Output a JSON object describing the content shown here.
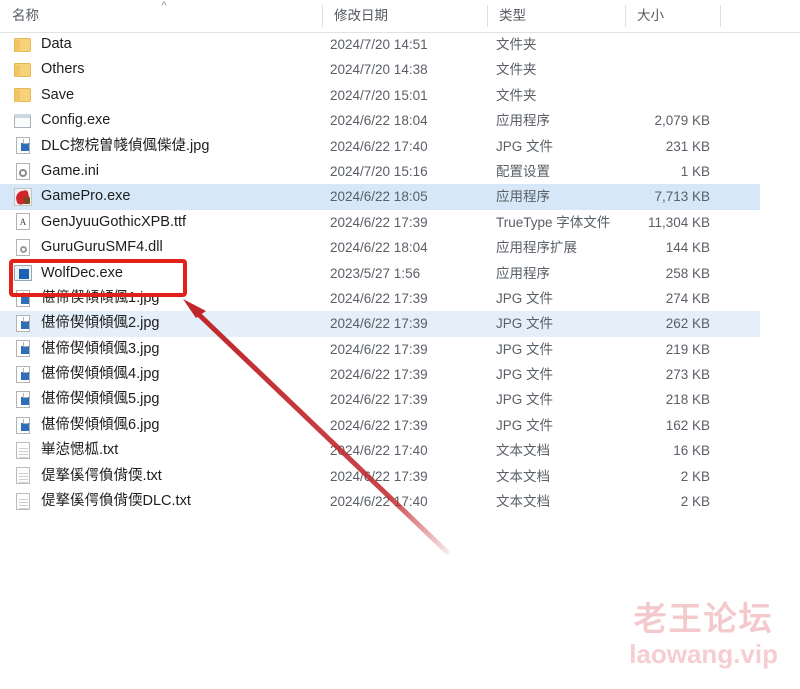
{
  "columns": {
    "name": "名称",
    "date_modified": "修改日期",
    "type": "类型",
    "size": "大小",
    "sort_indicator": "chevron-up-icon"
  },
  "files": [
    {
      "name": "Data",
      "icon": "folder",
      "date": "2024/7/20 14:51",
      "type": "文件夹",
      "size": "",
      "selected": "none"
    },
    {
      "name": "Others",
      "icon": "folder",
      "date": "2024/7/20 14:38",
      "type": "文件夹",
      "size": "",
      "selected": "none"
    },
    {
      "name": "Save",
      "icon": "folder",
      "date": "2024/7/20 15:01",
      "type": "文件夹",
      "size": "",
      "selected": "none"
    },
    {
      "name": "Config.exe",
      "icon": "window",
      "date": "2024/6/22 18:04",
      "type": "应用程序",
      "size": "2,079 KB",
      "selected": "none"
    },
    {
      "name": "DLC揔梡曽帴偵偑偨偼.jpg",
      "icon": "jpg",
      "date": "2024/6/22 17:40",
      "type": "JPG 文件",
      "size": "231 KB",
      "selected": "none"
    },
    {
      "name": "Game.ini",
      "icon": "ini",
      "date": "2024/7/20 15:16",
      "type": "配置设置",
      "size": "1 KB",
      "selected": "none"
    },
    {
      "name": "GamePro.exe",
      "icon": "redapp",
      "date": "2024/6/22 18:05",
      "type": "应用程序",
      "size": "7,713 KB",
      "selected": "full"
    },
    {
      "name": "GenJyuuGothicXPB.ttf",
      "icon": "ttf",
      "date": "2024/6/22 17:39",
      "type": "TrueType 字体文件",
      "size": "11,304 KB",
      "selected": "none"
    },
    {
      "name": "GuruGuruSMF4.dll",
      "icon": "dll",
      "date": "2024/6/22 18:04",
      "type": "应用程序扩展",
      "size": "144 KB",
      "selected": "none"
    },
    {
      "name": "WolfDec.exe",
      "icon": "blueapp",
      "date": "2023/5/27 1:56",
      "type": "应用程序",
      "size": "258 KB",
      "selected": "none"
    },
    {
      "name": "偡偙偰傾傾偑1.jpg",
      "icon": "jpg",
      "date": "2024/6/22 17:39",
      "type": "JPG 文件",
      "size": "274 KB",
      "selected": "none"
    },
    {
      "name": "偡偙偰傾傾偑2.jpg",
      "icon": "jpg",
      "date": "2024/6/22 17:39",
      "type": "JPG 文件",
      "size": "262 KB",
      "selected": "soft"
    },
    {
      "name": "偡偙偰傾傾偑3.jpg",
      "icon": "jpg",
      "date": "2024/6/22 17:39",
      "type": "JPG 文件",
      "size": "219 KB",
      "selected": "none"
    },
    {
      "name": "偡偙偰傾傾偑4.jpg",
      "icon": "jpg",
      "date": "2024/6/22 17:39",
      "type": "JPG 文件",
      "size": "273 KB",
      "selected": "none"
    },
    {
      "name": "偡偙偰傾傾偑5.jpg",
      "icon": "jpg",
      "date": "2024/6/22 17:39",
      "type": "JPG 文件",
      "size": "218 KB",
      "selected": "none"
    },
    {
      "name": "偡偙偰傾傾偑6.jpg",
      "icon": "jpg",
      "date": "2024/6/22 17:39",
      "type": "JPG 文件",
      "size": "162 KB",
      "selected": "none"
    },
    {
      "name": "崋惉愢柧.txt",
      "icon": "txt",
      "date": "2024/6/22 17:40",
      "type": "文本文档",
      "size": "16 KB",
      "selected": "none"
    },
    {
      "name": "偍撉傒偔偩偝偄.txt",
      "icon": "txt",
      "date": "2024/6/22 17:39",
      "type": "文本文档",
      "size": "2 KB",
      "selected": "none"
    },
    {
      "name": "偍撉傒偔偩偝偄DLC.txt",
      "icon": "txt",
      "date": "2024/6/22 17:40",
      "type": "文本文档",
      "size": "2 KB",
      "selected": "none"
    }
  ],
  "annotation": {
    "highlight_target": "WolfDec.exe",
    "highlight_color": "#e32119",
    "arrow_color": "#c0262b"
  },
  "watermark": {
    "brand": "老王论坛",
    "url": "laowang.vip",
    "color": "#f3c9cc"
  }
}
